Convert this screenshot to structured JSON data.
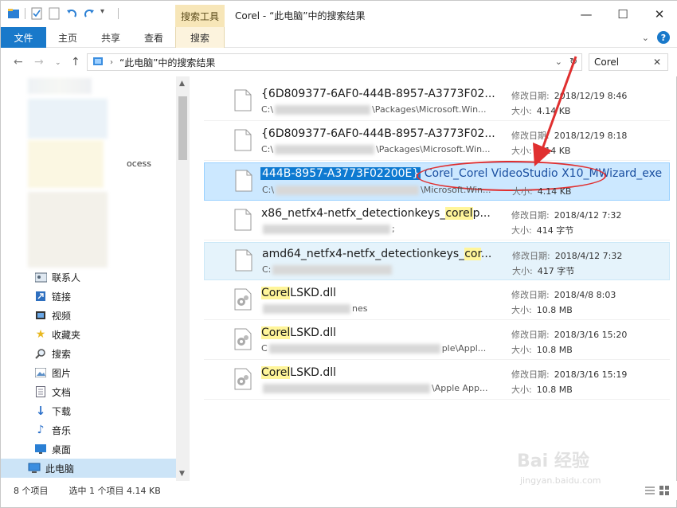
{
  "title_bar": {
    "context_tab_header": "搜索工具",
    "window_title": "Corel - “此电脑”中的搜索结果",
    "minimize": "—",
    "maximize": "☐",
    "close": "✕"
  },
  "ribbon": {
    "tabs": [
      "文件",
      "主页",
      "共享",
      "查看",
      "搜索"
    ]
  },
  "address_bar": {
    "path": "“此电脑”中的搜索结果",
    "search_value": "Corel"
  },
  "nav_pane": {
    "partial_label": "ocess",
    "items": [
      {
        "label": "联系人",
        "icon": "contacts-icon"
      },
      {
        "label": "链接",
        "icon": "links-icon"
      },
      {
        "label": "视频",
        "icon": "videos-icon"
      },
      {
        "label": "收藏夹",
        "icon": "favorites-star-icon"
      },
      {
        "label": "搜索",
        "icon": "search-icon"
      },
      {
        "label": "图片",
        "icon": "pictures-icon"
      },
      {
        "label": "文档",
        "icon": "documents-icon"
      },
      {
        "label": "下载",
        "icon": "downloads-icon"
      },
      {
        "label": "音乐",
        "icon": "music-icon"
      },
      {
        "label": "桌面",
        "icon": "desktop-icon"
      },
      {
        "label": "此电脑",
        "icon": "this-pc-icon"
      }
    ]
  },
  "results": {
    "date_label": "修改日期:",
    "size_label": "大小:",
    "items": [
      {
        "name": "{6D809377-6AF0-444B-8957-A3773F02...",
        "highlight": "",
        "name_after": "",
        "path_prefix": "C:\\",
        "path_suffix": "\\Packages\\Microsoft.Win...",
        "date": "2018/12/19 8:46",
        "size": "4.14 KB",
        "icon": "file-icon"
      },
      {
        "name": "{6D809377-6AF0-444B-8957-A3773F02...",
        "highlight": "",
        "name_after": "",
        "path_prefix": "C:\\",
        "path_suffix": "\\Packages\\Microsoft.Win...",
        "date": "2018/12/19 8:18",
        "size": "4.14 KB",
        "icon": "file-icon"
      },
      {
        "name_selected": "444B-8957-A3773F02200E}",
        "name_rest": "Corel_Corel VideoStudio X10_MWizard_exe",
        "path_prefix": "C:\\",
        "path_suffix": "\\Microsoft.Win...",
        "date": "",
        "size": "4.14 KB",
        "icon": "file-icon"
      },
      {
        "name": "x86_netfx4-netfx_detectionkeys_",
        "highlight": "corel",
        "name_after": "p...",
        "path_prefix": "",
        "path_suffix": ";",
        "date": "2018/4/12 7:32",
        "size": "414 字节",
        "icon": "file-icon"
      },
      {
        "name": "amd64_netfx4-netfx_detectionkeys_",
        "highlight": "cor",
        "name_after": "...",
        "path_prefix": "C:",
        "path_suffix": "",
        "date": "2018/4/12 7:32",
        "size": "417 字节",
        "icon": "file-icon"
      },
      {
        "name": "",
        "highlight": "Corel",
        "name_after": "LSKD.dll",
        "path_prefix": "",
        "path_suffix": "nes",
        "date": "2018/4/8 8:03",
        "size": "10.8 MB",
        "icon": "dll-gear-icon"
      },
      {
        "name": "",
        "highlight": "Corel",
        "name_after": "LSKD.dll",
        "path_prefix": "C",
        "path_suffix": "ple\\Appl...",
        "date": "2018/3/16 15:20",
        "size": "10.8 MB",
        "icon": "dll-gear-icon"
      },
      {
        "name": "",
        "highlight": "Corel",
        "name_after": "LSKD.dll",
        "path_prefix": "",
        "path_suffix": "\\Apple App...",
        "date": "2018/3/16 15:19",
        "size": "10.8 MB",
        "icon": "dll-gear-icon"
      }
    ]
  },
  "status_bar": {
    "count": "8 个项目",
    "selection": "选中 1 个项目  4.14 KB"
  },
  "watermark": {
    "text": "Bai 经验",
    "url": "jingyan.baidu.com"
  },
  "colors": {
    "accent": "#1979ca",
    "selection": "#cce8ff",
    "highlight": "#fff59a",
    "annotation_red": "#e02f2f"
  }
}
